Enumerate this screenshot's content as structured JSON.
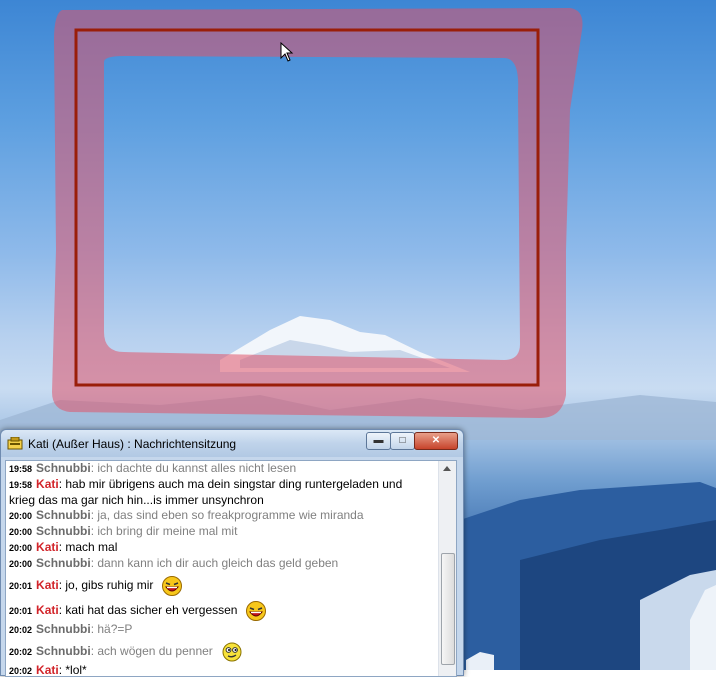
{
  "window": {
    "title": "Kati (Außer Haus) : Nachrichtensitzung",
    "controls": {
      "minimize": "▬",
      "maximize": "□",
      "close": "✕"
    }
  },
  "messages": [
    {
      "time": "19:58",
      "nick": "Schnubbi",
      "text": "ich dachte du kannst alles nicht lesen",
      "who": "s"
    },
    {
      "time": "19:58",
      "nick": "Kati",
      "text": "hab mir übrigens auch ma dein singstar ding runtergeladen und krieg das ma gar nich hin...is immer unsynchron",
      "who": "k"
    },
    {
      "time": "20:00",
      "nick": "Schnubbi",
      "text": "ja, das sind eben so freakprogramme wie miranda",
      "who": "s"
    },
    {
      "time": "20:00",
      "nick": "Schnubbi",
      "text": "ich bring dir meine mal mit",
      "who": "s"
    },
    {
      "time": "20:00",
      "nick": "Kati",
      "text": "mach mal",
      "who": "k"
    },
    {
      "time": "20:00",
      "nick": "Schnubbi",
      "text": "dann kann ich dir auch gleich das geld geben",
      "who": "s"
    },
    {
      "time": "20:01",
      "nick": "Kati",
      "text": "jo, gibs ruhig mir",
      "who": "k",
      "emoticon": "laughing-emoticon"
    },
    {
      "time": "20:01",
      "nick": "Kati",
      "text": "kati hat das sicher eh vergessen",
      "who": "k",
      "emoticon": "laughing-emoticon"
    },
    {
      "time": "20:02",
      "nick": "Schnubbi",
      "text": "hä?=P",
      "who": "s"
    },
    {
      "time": "20:02",
      "nick": "Schnubbi",
      "text": "ach wögen du penner",
      "who": "s",
      "emoticon": "winking-emoticon"
    },
    {
      "time": "20:02",
      "nick": "Kati",
      "text": "*lol*",
      "who": "k"
    }
  ],
  "colors": {
    "nick_schnubbi": "#6b6b6b",
    "nick_kati": "#d2242a",
    "annotation_highlight": "#e0546a",
    "annotation_frame": "#9a1e0a"
  }
}
